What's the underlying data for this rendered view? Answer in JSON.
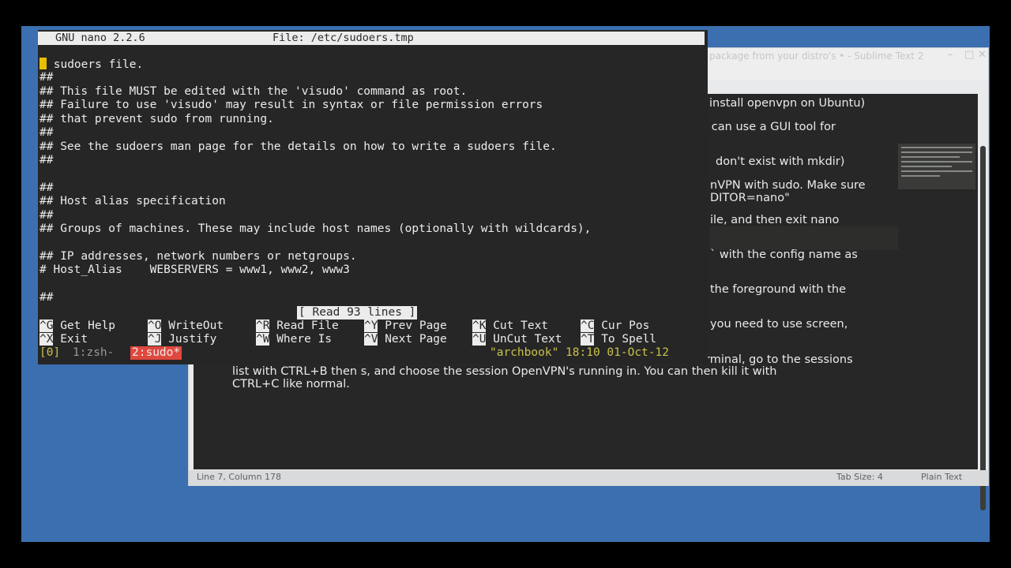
{
  "sublime": {
    "title": "package from your distro's • - Sublime Text 2",
    "controls": [
      "–",
      "□",
      "✕"
    ],
    "visible_lines": [
      "install openvpn on Ubuntu)",
      "u can use a GUI tool for",
      "don't exist with mkdir)",
      "nVPN with sudo. Make sure",
      "DITOR=nano\"",
      "ile, and then exit nano",
      "` with the config name as",
      "the foreground with the",
      "you need to use screen,",
      "rminal, go to the sessions",
      "list with CTRL+B then s, and choose the session OpenVPN's running in. You can then kill it with",
      "CTRL+C like normal."
    ],
    "status_left": "Line 7, Column 178",
    "status_tab": "Tab Size: 4",
    "status_syntax": "Plain Text"
  },
  "nano": {
    "title_left": "GNU nano 2.2.6",
    "title_file": "File: /etc/sudoers.tmp",
    "lines": [
      "# sudoers file.",
      "##",
      "## This file MUST be edited with the 'visudo' command as root.",
      "## Failure to use 'visudo' may result in syntax or file permission errors",
      "## that prevent sudo from running.",
      "##",
      "## See the sudoers man page for the details on how to write a sudoers file.",
      "##",
      "",
      "##",
      "## Host alias specification",
      "##",
      "## Groups of machines. These may include host names (optionally with wildcards),",
      "",
      "## IP addresses, network numbers or netgroups.",
      "# Host_Alias    WEBSERVERS = www1, www2, www3",
      "",
      "##"
    ],
    "first_char": "#",
    "status_message": "[ Read 93 lines ]",
    "shortcuts_row1": [
      {
        "key": "^G",
        "label": "Get Help"
      },
      {
        "key": "^O",
        "label": "WriteOut"
      },
      {
        "key": "^R",
        "label": "Read File"
      },
      {
        "key": "^Y",
        "label": "Prev Page"
      },
      {
        "key": "^K",
        "label": "Cut Text"
      },
      {
        "key": "^C",
        "label": "Cur Pos"
      }
    ],
    "shortcuts_row2": [
      {
        "key": "^X",
        "label": "Exit"
      },
      {
        "key": "^J",
        "label": "Justify"
      },
      {
        "key": "^W",
        "label": "Where Is"
      },
      {
        "key": "^V",
        "label": "Next Page"
      },
      {
        "key": "^U",
        "label": "UnCut Text"
      },
      {
        "key": "^T",
        "label": "To Spell"
      }
    ]
  },
  "tmux": {
    "session": "[0]",
    "window1": "1:zsh-",
    "window2": "2:sudo*",
    "right": "\"archbook\" 18:10 01-Oct-12"
  },
  "colors": {
    "desktop": "#3b6fb0",
    "terminal_bg": "#262626",
    "cursor": "#e6c000",
    "tmux_active": "#e0483e",
    "tmux_status": "#c9c24a"
  }
}
